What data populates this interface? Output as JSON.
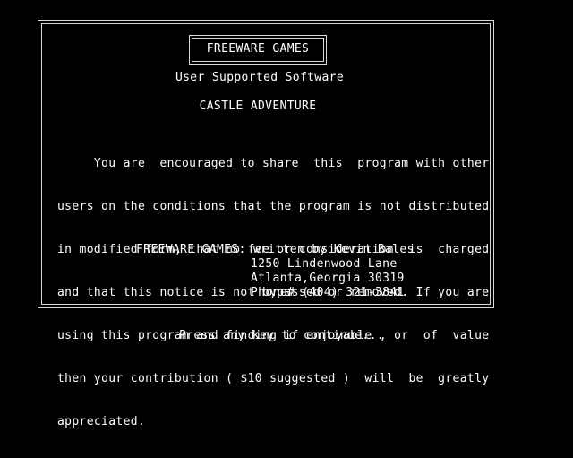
{
  "title_box": {
    "label": "FREEWARE GAMES"
  },
  "subtitle": "User Supported Software",
  "game_title": "CASTLE ADVENTURE",
  "notice_lines": [
    "     You are  encouraged to share  this  program with other",
    "users on the conditions that the program is not distributed",
    "in modified form, that no fee or consideration  is  charged",
    "and that this notice is not bypassed or removed. If you are",
    "using this program and finding if enjoyable , or  of  value",
    "then your contribution ( $10 suggested )  will  be  greatly",
    "appreciated."
  ],
  "credit": {
    "line": "FREEWARE GAMES: written by Kevin Bales",
    "address_lines": [
      "1250 Lindenwood Lane",
      "Atlanta,Georgia 30319",
      "Phone# (404) 321-3841"
    ]
  },
  "prompt": "Press any key to continue...",
  "colors": {
    "background": "#000000",
    "text": "#ffffff",
    "border": "#d8d8d8"
  }
}
